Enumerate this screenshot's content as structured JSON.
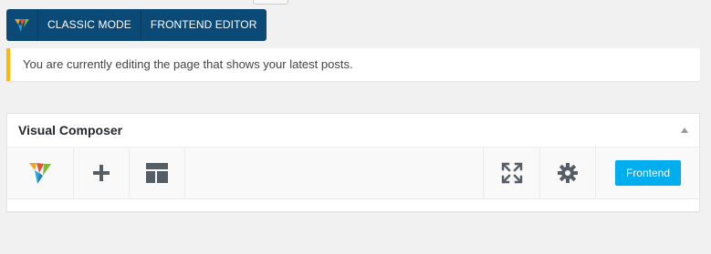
{
  "toggle": {
    "classic_label": "CLASSIC MODE",
    "frontend_label": "FRONTEND EDITOR"
  },
  "notice": {
    "text": "You are currently editing the page that shows your latest posts."
  },
  "panel": {
    "title": "Visual Composer",
    "frontend_button": "Frontend"
  },
  "colors": {
    "toggle_bg": "#0b4a77",
    "notice_accent": "#ffb900",
    "frontend_button": "#00aeef",
    "icon": "#555d66"
  },
  "icons": [
    "vc-logo-icon",
    "plus-icon",
    "layout-icon",
    "fullscreen-icon",
    "gear-icon",
    "collapse-arrow-icon"
  ]
}
